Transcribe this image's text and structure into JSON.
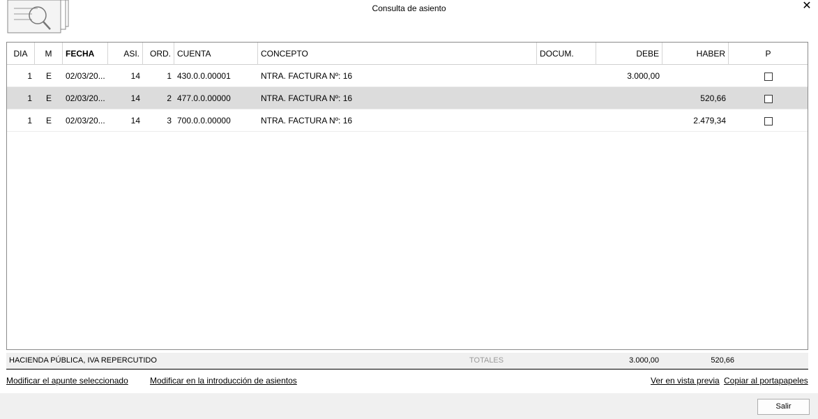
{
  "window": {
    "title": "Consulta de asiento"
  },
  "columns": {
    "dia": "DIA",
    "m": "M",
    "fecha": "FECHA",
    "asi": "ASI.",
    "ord": "ORD.",
    "cuenta": "CUENTA",
    "concepto": "CONCEPTO",
    "docum": "DOCUM.",
    "debe": "DEBE",
    "haber": "HABER",
    "p": "P"
  },
  "rows": [
    {
      "dia": "1",
      "m": "E",
      "fecha": "02/03/20...",
      "asi": "14",
      "ord": "1",
      "cuenta": "430.0.0.00001",
      "concepto": "NTRA. FACTURA Nº:  16",
      "docum": "",
      "debe": "3.000,00",
      "haber": "",
      "p": false
    },
    {
      "dia": "1",
      "m": "E",
      "fecha": "02/03/20...",
      "asi": "14",
      "ord": "2",
      "cuenta": "477.0.0.00000",
      "concepto": "NTRA. FACTURA Nº:  16",
      "docum": "",
      "debe": "",
      "haber": "520,66",
      "p": false
    },
    {
      "dia": "1",
      "m": "E",
      "fecha": "02/03/20...",
      "asi": "14",
      "ord": "3",
      "cuenta": "700.0.0.00000",
      "concepto": "NTRA. FACTURA Nº:  16",
      "docum": "",
      "debe": "",
      "haber": "2.479,34",
      "p": false
    }
  ],
  "status": {
    "account_name": "HACIENDA PÚBLICA, IVA REPERCUTIDO",
    "totals_label": "TOTALES",
    "total_debe": "3.000,00",
    "total_haber": "520,66"
  },
  "links": {
    "modify_selected": "Modificar el apunte seleccionado",
    "modify_in_entry": "Modificar en la introducción de asientos",
    "print_preview": "Ver en vista previa",
    "copy_clipboard": "Copiar al portapapeles"
  },
  "footer": {
    "exit_label": "Salir"
  },
  "icons": {
    "header": "document-search-icon",
    "close": "close-icon"
  },
  "selected_row_color": "#dcdcdc"
}
